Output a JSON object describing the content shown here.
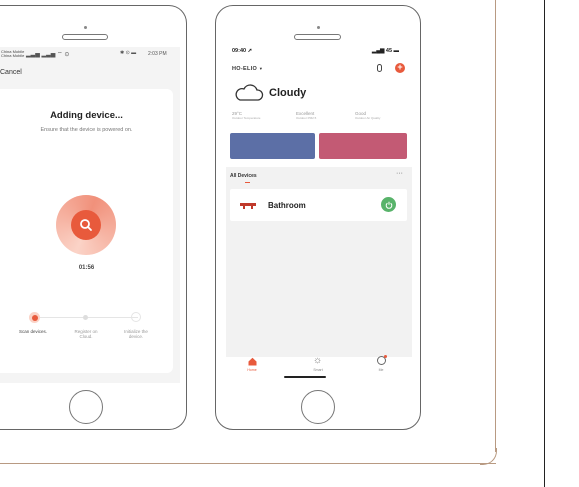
{
  "phone1": {
    "status_carrier": "China Mobile",
    "status_carrier2": "China Mobile",
    "status_right": "2:03 PM",
    "cancel_label": "Cancel",
    "title": "Adding device...",
    "subtitle": "Ensure that the device is powered on.",
    "timer": "01:56",
    "steps": [
      {
        "label": "Scan devices.",
        "active": true
      },
      {
        "label": "Register on Cloud.",
        "active": false
      },
      {
        "label": "Initialize the device.",
        "active": false
      }
    ]
  },
  "phone2": {
    "time": "09:40",
    "battery": "45",
    "home_name": "HO-ELIO",
    "weather": "Cloudy",
    "weather_stats": [
      {
        "value": "29°C",
        "label": "Outdoor Temperature"
      },
      {
        "value": "Excellent",
        "label": "Outdoor PM2.5"
      },
      {
        "value": "Good",
        "label": "Outdoor Air Quality"
      }
    ],
    "section_title": "All Devices",
    "more": "···",
    "device_name": "Bathroom",
    "tabs": [
      "Home",
      "Smart",
      "Me"
    ]
  },
  "colors": {
    "accent": "#e85a3c",
    "blue_card": "#5c6fa6",
    "pink_card": "#c35a74",
    "power_green": "#58b36a"
  }
}
